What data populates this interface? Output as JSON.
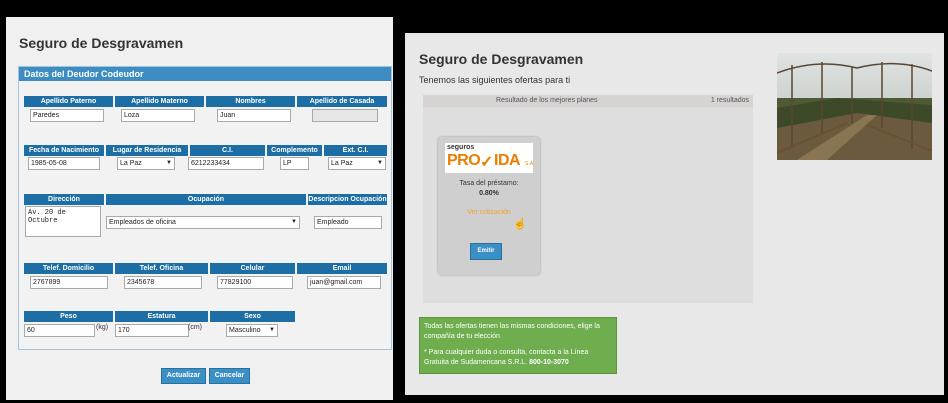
{
  "left": {
    "title": "Seguro de Desgravamen",
    "section_header": "Datos del Deudor Codeudor",
    "row1": {
      "labels": [
        "Apellido Paterno",
        "Apellido Materno",
        "Nombres",
        "Apellido de Casada"
      ],
      "values": [
        "Paredes",
        "Loza",
        "Juan",
        ""
      ]
    },
    "row2": {
      "labels": [
        "Fecha de Nacimiento",
        "Lugar de Residencia",
        "C.I.",
        "Complemento",
        "Ext. C.I."
      ],
      "values": [
        "1985-05-08",
        "La Paz",
        "6212233434",
        "LP",
        "La Paz"
      ]
    },
    "row3": {
      "labels": [
        "Dirección",
        "Ocupación",
        "Descripcion Ocupación"
      ],
      "values": [
        "Av. 20 de Octubre",
        "Empleados de oficina",
        "Empleado"
      ]
    },
    "row4": {
      "labels": [
        "Telef. Domicilio",
        "Telef. Oficina",
        "Celular",
        "Email"
      ],
      "values": [
        "2767899",
        "2345678",
        "77829100",
        "juan@gmail.com"
      ]
    },
    "row5": {
      "labels": [
        "Peso",
        "Estatura",
        "Sexo"
      ],
      "values": [
        "60",
        "170",
        "Masculino"
      ],
      "units": [
        "(kg)",
        "(cm)"
      ]
    },
    "buttons": {
      "update": "Actualizar",
      "cancel": "Cancelar"
    }
  },
  "right": {
    "title": "Seguro de Desgravamen",
    "subtitle": "Tenemos las siguientes ofertas para ti",
    "results_label": "Resultado de los mejores planes",
    "results_count": "1 resultados",
    "card": {
      "logo_top": "seguros",
      "logo_main_1": "PRO",
      "logo_main_2": "IDA",
      "logo_suffix": "S.A.",
      "rate_label": "Tasa del préstamo:",
      "rate_value": "0.80%",
      "quote_link": "Ver cotización",
      "emit_button": "Emitir"
    },
    "info": {
      "line1": "Todas las ofertas tienen las mismas condiciones, elige la compañía de tu elección",
      "line2": "* Para cualquier duda o consulta, contacta a la Línea Gratuita de Sudamericana S.R.L.",
      "phone": "800-10-3070"
    }
  }
}
